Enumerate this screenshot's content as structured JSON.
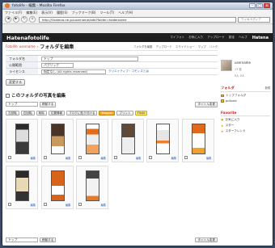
{
  "window": {
    "title": "fotolife - 編集 - Mozilla Firefox"
  },
  "menu": [
    "ファイル(F)",
    "編集(E)",
    "表示(V)",
    "履歴(S)",
    "ブックマーク(B)",
    "ツール(T)",
    "ヘルプ(H)"
  ],
  "nav": {
    "url": "http://f.hatena.ne.jp/username/edit?folder=foldername",
    "search_placeholder": "ウィキペディア"
  },
  "header": {
    "logo": "Hatenafotolife",
    "links": [
      "マイフォト",
      "お気に入り",
      "アップロード",
      "設定",
      "ヘルプ"
    ],
    "brand": "Hatena"
  },
  "breadcrumb": {
    "root": "Fotolife",
    "user": "username"
  },
  "page": {
    "title": "フォルダを編集",
    "tools": [
      "フォルダを編集",
      "アップロード",
      "スライドショー",
      "マップ",
      "リンク"
    ]
  },
  "form": {
    "name_label": "フォルダ名",
    "name_value": "トップ",
    "public_label": "公開範囲",
    "public_value": "パブリック",
    "license_label": "ライセンス",
    "license_value": "指定なし (All rights reserved)",
    "license_link": "クリエイティブ・コモンズとは",
    "save": "変更する"
  },
  "photos_section": {
    "title": "このフォルダの写真を編集",
    "folder_select": "トップ",
    "move_button": "移動する",
    "title_change": "タイトル変更",
    "actions": [
      "左回転",
      "右回転",
      "削除",
      "位置情報",
      "ブログに貼り付ける",
      "Blogger",
      "プリント",
      "Flickr"
    ],
    "edit_link": "編集"
  },
  "sidebar": {
    "username": "username",
    "stats": "17 枚",
    "sub": "0人   0人",
    "folders_heading": "フォルダ",
    "folders_action": "新規",
    "folders": [
      "トップフォルダ",
      "pullonic"
    ],
    "favorite_heading": "Favorite",
    "favorites": [
      "お気に入り",
      "スター",
      "スターフレンド"
    ]
  }
}
